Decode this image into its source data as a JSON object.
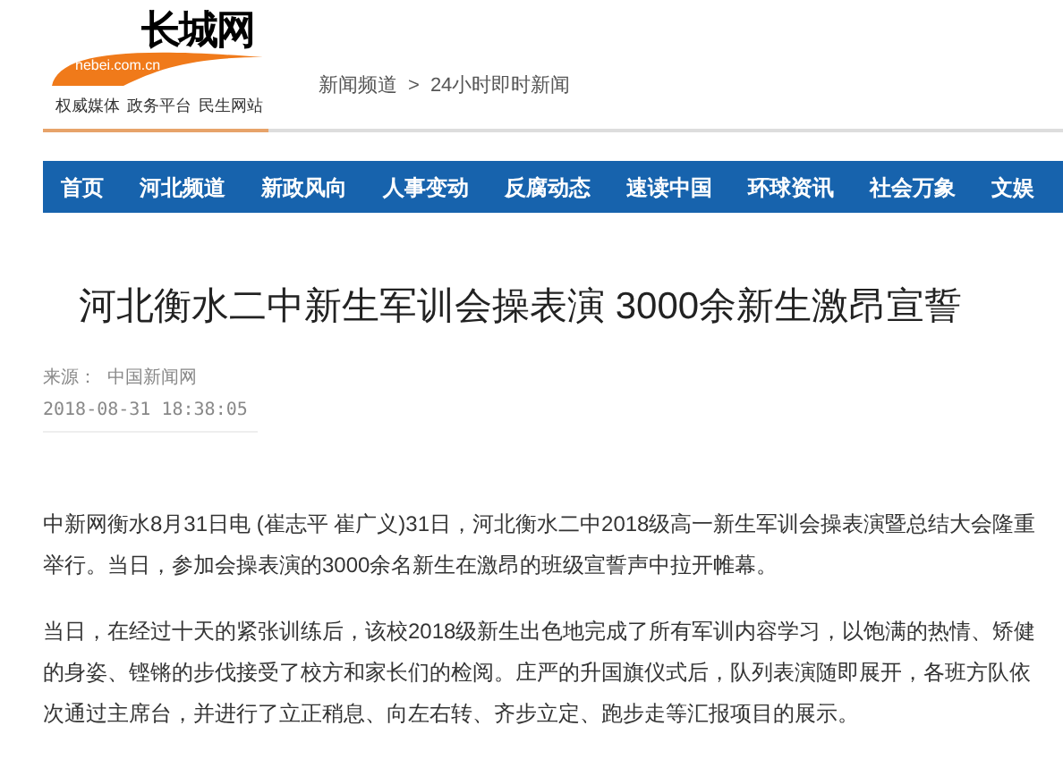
{
  "header": {
    "logo_text": "长城网",
    "logo_domain": "hebei.com.cn",
    "taglines": [
      "权威媒体",
      "政务平台",
      "民生网站"
    ],
    "breadcrumb": [
      "新闻频道",
      "24小时即时新闻"
    ],
    "breadcrumb_separator": ">"
  },
  "nav": {
    "items": [
      {
        "label": "首页"
      },
      {
        "label": "河北频道"
      },
      {
        "label": "新政风向"
      },
      {
        "label": "人事变动"
      },
      {
        "label": "反腐动态"
      },
      {
        "label": "速读中国"
      },
      {
        "label": "环球资讯"
      },
      {
        "label": "社会万象"
      },
      {
        "label": "文娱"
      }
    ]
  },
  "article": {
    "title": "河北衡水二中新生军训会操表演 3000余新生激昂宣誓",
    "source_label": "来源：",
    "source": "中国新闻网",
    "datetime": "2018-08-31 18:38:05",
    "paragraphs": [
      "中新网衡水8月31日电 (崔志平 崔广义)31日，河北衡水二中2018级高一新生军训会操表演暨总结大会隆重举行。当日，参加会操表演的3000余名新生在激昂的班级宣誓声中拉开帷幕。",
      "当日，在经过十天的紧张训练后，该校2018级新生出色地完成了所有军训内容学习，以饱满的热情、矫健的身姿、铿锵的步伐接受了校方和家长们的检阅。庄严的升国旗仪式后，队列表演随即展开，各班方队依次通过主席台，并进行了立正稍息、向左右转、齐步立定、跑步走等汇报项目的展示。"
    ]
  }
}
